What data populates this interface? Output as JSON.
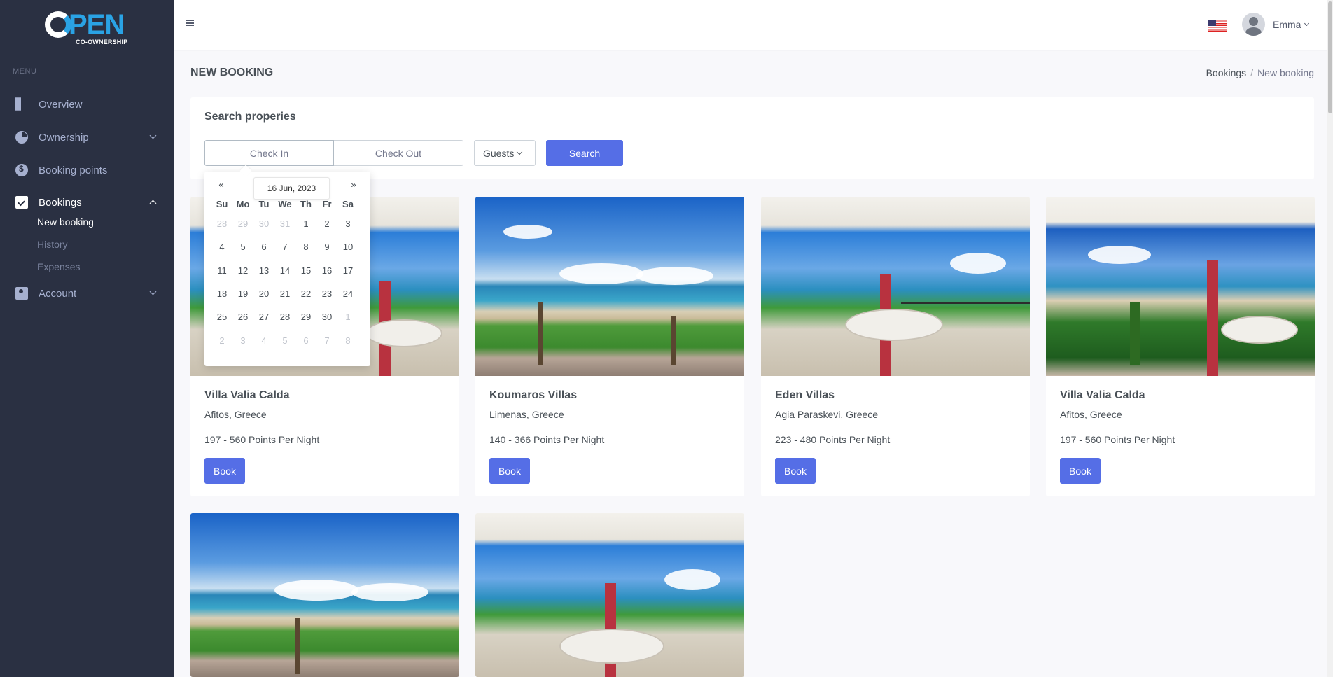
{
  "brand": {
    "word": "PEN",
    "sub": "CO-OWNERSHIP"
  },
  "sidebar": {
    "menu_title": "MENU",
    "items": [
      {
        "label": "Overview",
        "icon": "grid-icon"
      },
      {
        "label": "Ownership",
        "icon": "pie-chart-icon"
      },
      {
        "label": "Booking points",
        "icon": "coin-icon"
      },
      {
        "label": "Bookings",
        "icon": "calendar-check-icon"
      },
      {
        "label": "Account",
        "icon": "account-icon"
      }
    ],
    "bookings_sub": [
      "New booking",
      "History",
      "Expenses"
    ]
  },
  "topbar": {
    "user": "Emma",
    "flag": "us-flag-icon"
  },
  "page": {
    "title": "NEW BOOKING",
    "breadcrumb": [
      "Bookings",
      "New booking"
    ]
  },
  "search": {
    "title": "Search properies",
    "check_in": "Check In",
    "check_out": "Check Out",
    "guests": "Guests",
    "button": "Search"
  },
  "datepicker": {
    "prev": "«",
    "next": "»",
    "tooltip": "16 Jun, 2023",
    "weekdays": [
      "Su",
      "Mo",
      "Tu",
      "We",
      "Th",
      "Fr",
      "Sa"
    ],
    "weeks": [
      [
        "28",
        "29",
        "30",
        "31",
        "1",
        "2",
        "3"
      ],
      [
        "4",
        "5",
        "6",
        "7",
        "8",
        "9",
        "10"
      ],
      [
        "11",
        "12",
        "13",
        "14",
        "15",
        "16",
        "17"
      ],
      [
        "18",
        "19",
        "20",
        "21",
        "22",
        "23",
        "24"
      ],
      [
        "25",
        "26",
        "27",
        "28",
        "29",
        "30",
        "1"
      ],
      [
        "2",
        "3",
        "4",
        "5",
        "6",
        "7",
        "8"
      ]
    ]
  },
  "properties": [
    {
      "name": "Villa Valia Calda",
      "location": "Afitos, Greece",
      "points": "197 - 560 Points Per Night",
      "book": "Book"
    },
    {
      "name": "Koumaros Villas",
      "location": "Limenas, Greece",
      "points": "140 - 366 Points Per Night",
      "book": "Book"
    },
    {
      "name": "Eden Villas",
      "location": "Agia Paraskevi, Greece",
      "points": "223 - 480 Points Per Night",
      "book": "Book"
    },
    {
      "name": "Villa Valia Calda",
      "location": "Afitos, Greece",
      "points": "197 - 560 Points Per Night",
      "book": "Book"
    }
  ],
  "colors": {
    "sidebar": "#2a3042",
    "accent": "#556ee6",
    "brand": "#2aa3e5"
  }
}
